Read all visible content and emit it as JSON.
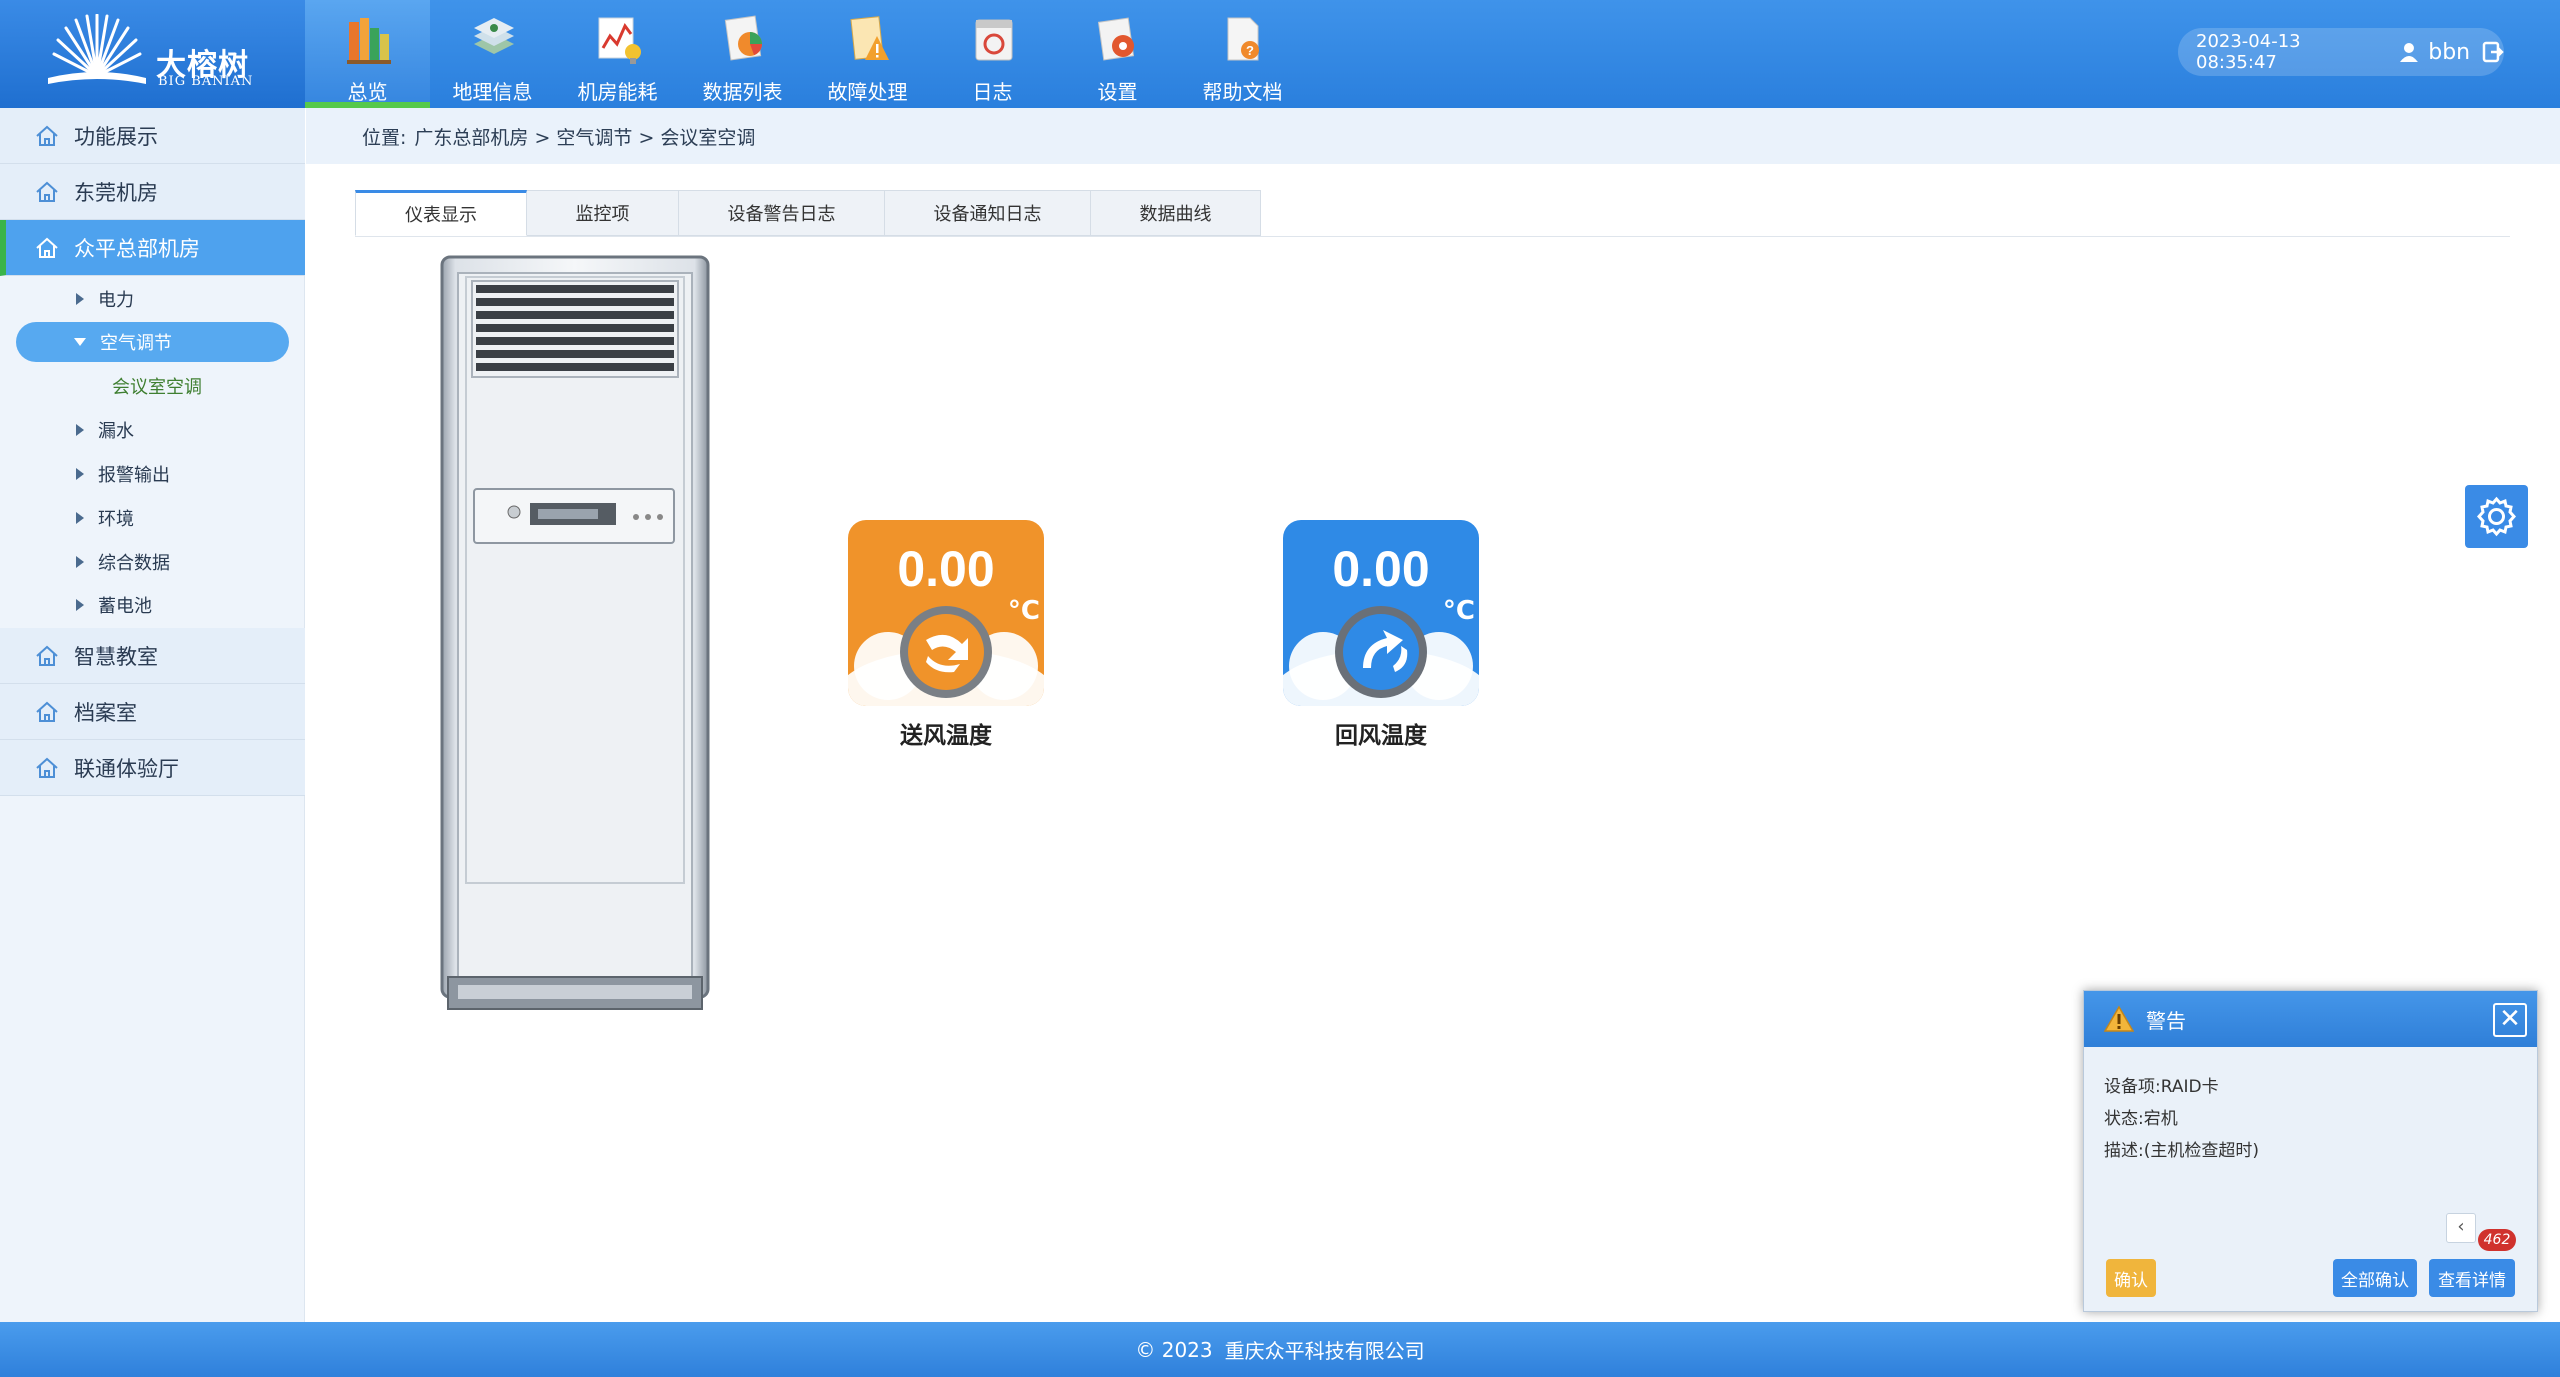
{
  "brand": {
    "name_cn": "大榕树",
    "name_en": "BIG BANIAN"
  },
  "top_nav": [
    {
      "label": "总览",
      "icon": "overview-books-icon",
      "active": true
    },
    {
      "label": "地理信息",
      "icon": "geo-map-icon",
      "active": false
    },
    {
      "label": "机房能耗",
      "icon": "energy-chart-icon",
      "active": false
    },
    {
      "label": "数据列表",
      "icon": "data-list-icon",
      "active": false
    },
    {
      "label": "故障处理",
      "icon": "fault-warning-icon",
      "active": false
    },
    {
      "label": "日志",
      "icon": "log-calendar-icon",
      "active": false
    },
    {
      "label": "设置",
      "icon": "settings-gear-icon",
      "active": false
    },
    {
      "label": "帮助文档",
      "icon": "help-doc-icon",
      "active": false
    }
  ],
  "user": {
    "datetime": "2023-04-13  08:35:47",
    "username": "bbn"
  },
  "sidebar": {
    "groups": [
      {
        "label": "功能展示"
      },
      {
        "label": "东莞机房"
      },
      {
        "label": "众平总部机房",
        "active": true
      },
      {
        "label": "智慧教室"
      },
      {
        "label": "档案室"
      },
      {
        "label": "联通体验厅"
      }
    ],
    "sub_items": [
      {
        "label": "电力"
      },
      {
        "label": "空气调节",
        "active": true
      },
      {
        "label": "漏水"
      },
      {
        "label": "报警输出"
      },
      {
        "label": "环境"
      },
      {
        "label": "综合数据"
      },
      {
        "label": "蓄电池"
      }
    ],
    "leaf": "会议室空调"
  },
  "breadcrumb": {
    "prefix": "位置:",
    "path": "广东总部机房 > 空气调节 > 会议室空调"
  },
  "tabs": [
    {
      "label": "仪表显示",
      "active": true
    },
    {
      "label": "监控项"
    },
    {
      "label": "设备警告日志"
    },
    {
      "label": "设备通知日志"
    },
    {
      "label": "数据曲线"
    }
  ],
  "gauges": [
    {
      "value": "0.00",
      "unit": "°C",
      "label": "送风温度",
      "color": "#f0932a"
    },
    {
      "value": "0.00",
      "unit": "°C",
      "label": "回风温度",
      "color": "#2f8ae6"
    }
  ],
  "alert": {
    "title": "警告",
    "lines": [
      "设备项:RAID卡",
      "状态:宕机",
      "描述:(主机检查超时)"
    ],
    "badge": "462",
    "confirm": "确认",
    "confirm_all": "全部确认",
    "view_detail": "查看详情",
    "prev": "‹",
    "close": "✕"
  },
  "footer": {
    "copyright": "© 2023",
    "company": "重庆众平科技有限公司"
  },
  "colors": {
    "header": "#2f82dc",
    "accent": "#3a8be6",
    "active_green": "#3ab44a",
    "warn": "#f0b53c",
    "badge": "#d0322d"
  }
}
